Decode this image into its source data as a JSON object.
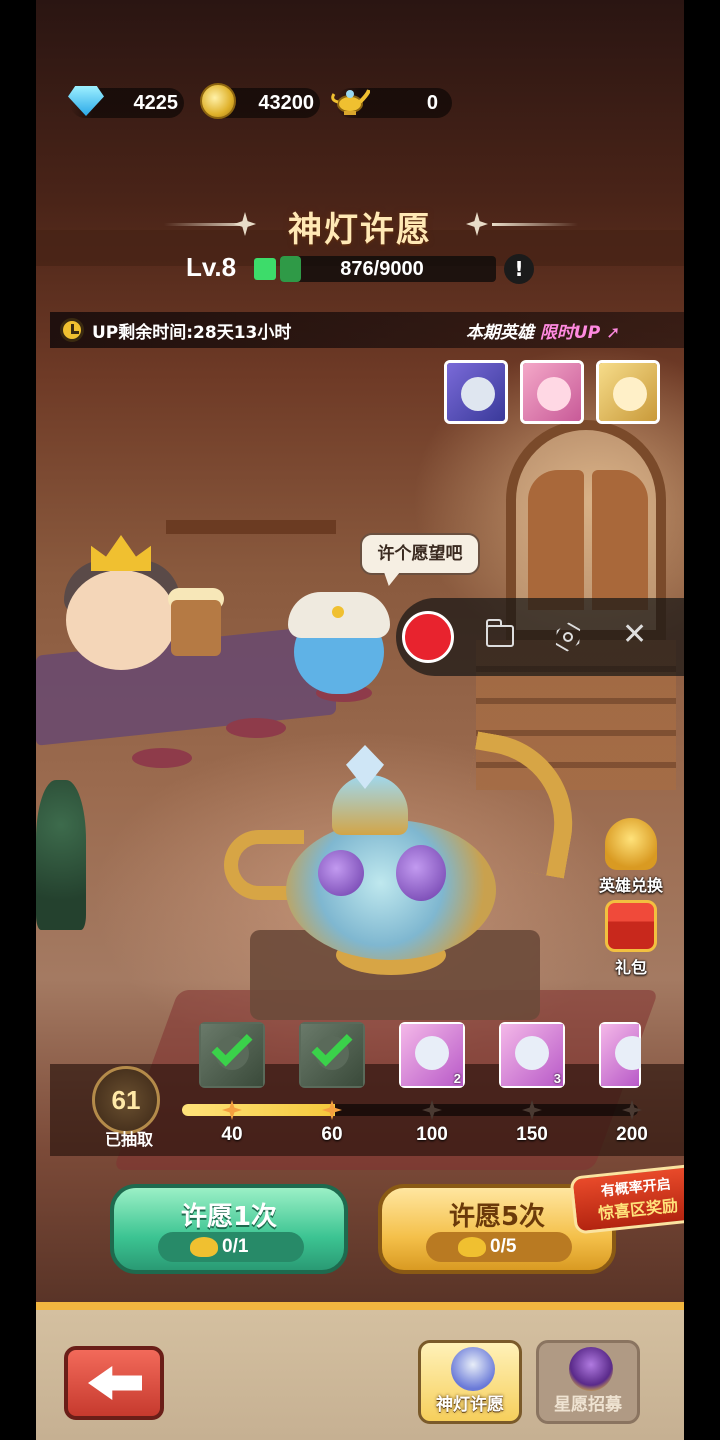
{
  "currencies": {
    "gems": {
      "value": "4225",
      "icon": "diamond-icon"
    },
    "coins": {
      "value": "43200",
      "icon": "gold-coin-icon"
    },
    "lamps": {
      "value": "0",
      "icon": "magic-lamp-icon"
    }
  },
  "header": {
    "title": "神灯许愿",
    "level": "Lv.8",
    "exp_text": "876/9000",
    "exp_fraction": 0.097,
    "info_label": "!"
  },
  "up_event": {
    "remaining_time": "UP剩余时间:28天13小时",
    "label_prefix": "本期英雄",
    "label_highlight": "限时UP",
    "heroes": [
      {
        "name": "hero-mech-knight",
        "color": "#6a7ad8"
      },
      {
        "name": "hero-pink-girl",
        "color": "#e888b8"
      },
      {
        "name": "hero-golden-angel",
        "color": "#e8c86a"
      }
    ]
  },
  "scene": {
    "speech_bubble": "许个愿望吧"
  },
  "recorder": {
    "icons": [
      "record-icon",
      "folder-icon",
      "settings-icon",
      "close-icon"
    ],
    "close_glyph": "✕"
  },
  "side_buttons": {
    "hero_exchange": "英雄兑换",
    "gift_pack": "礼包"
  },
  "draw_progress": {
    "count": "61",
    "count_label": "已抽取",
    "current": 61,
    "milestones": [
      {
        "value": 40,
        "label": "40",
        "reached": true,
        "reward_claimed": true
      },
      {
        "value": 60,
        "label": "60",
        "reached": true,
        "reward_claimed": true
      },
      {
        "value": 100,
        "label": "100",
        "reached": false,
        "reward_count": "2"
      },
      {
        "value": 150,
        "label": "150",
        "reached": false,
        "reward_count": "3"
      },
      {
        "value": 200,
        "label": "200",
        "reached": false,
        "reward_count": ""
      }
    ]
  },
  "wish_buttons": {
    "once": {
      "label": "许愿1次",
      "cost": "0/1"
    },
    "five": {
      "label": "许愿5次",
      "cost": "0/5"
    },
    "promo_line1": "有概率开启",
    "promo_line2": "惊喜区奖励"
  },
  "bottom_nav": {
    "back_icon": "back-arrow-icon",
    "tabs": [
      {
        "label": "神灯许愿",
        "active": true
      },
      {
        "label": "星愿招募",
        "active": false
      }
    ]
  },
  "colors": {
    "accent_gold": "#f4c04a",
    "accent_green": "#3cc492",
    "exp_green": "#2f9a47",
    "record_red": "#e8232e"
  }
}
